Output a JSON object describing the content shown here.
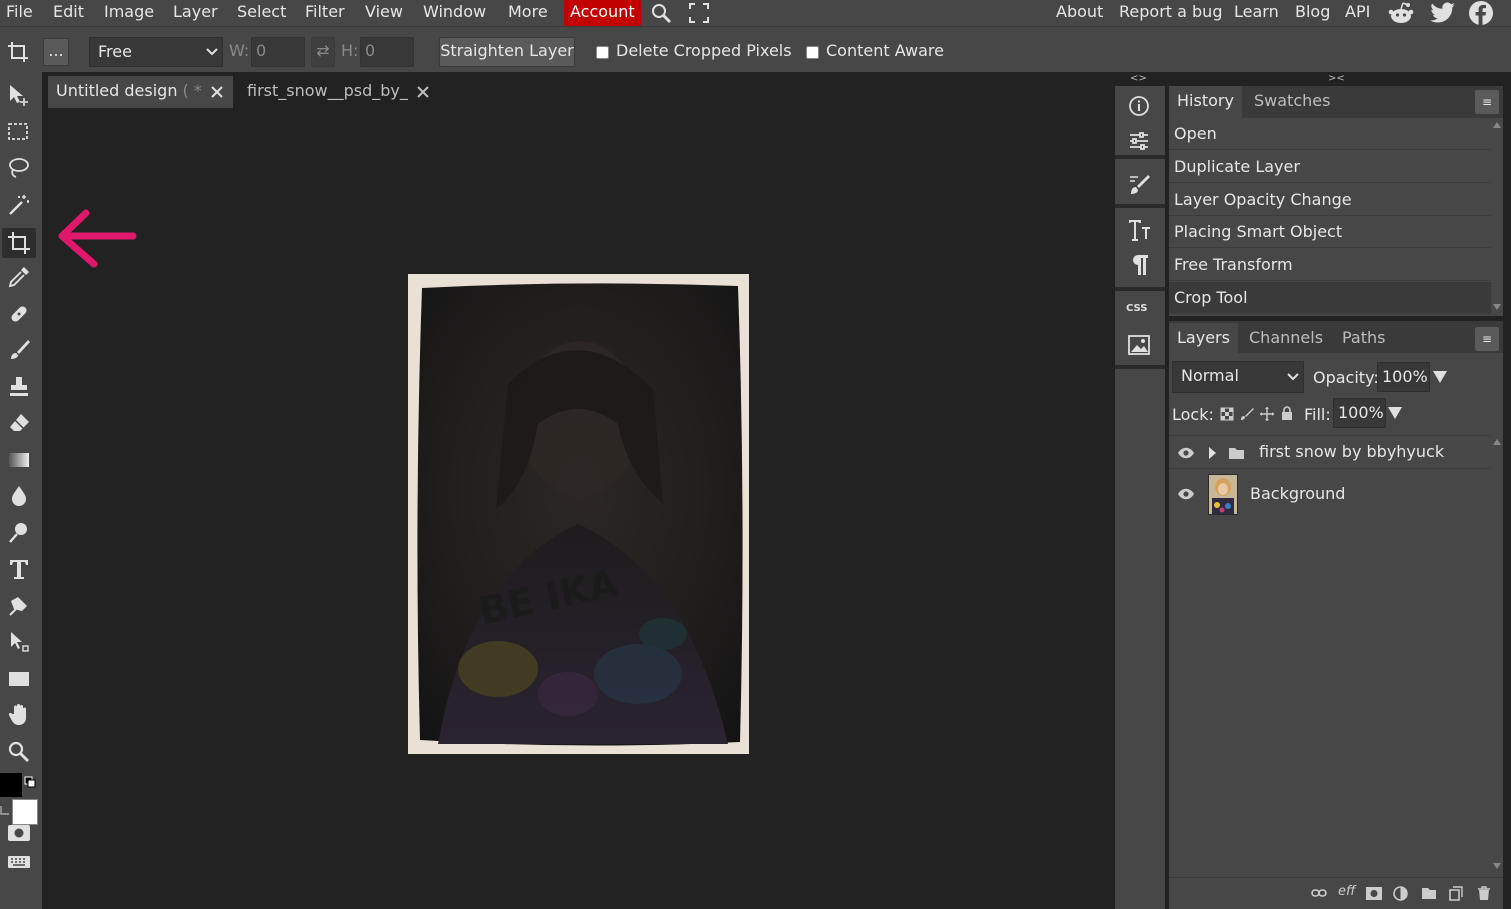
{
  "menu": {
    "left": [
      "File",
      "Edit",
      "Image",
      "Layer",
      "Select",
      "Filter",
      "View",
      "Window",
      "More"
    ],
    "account": "Account",
    "right": [
      "About",
      "Report a bug",
      "Learn",
      "Blog",
      "API"
    ],
    "colors": {
      "account_bg": "#c20000",
      "bar_bg": "#474747"
    }
  },
  "options": {
    "more_label": "...",
    "mode_value": "Free",
    "w_label": "W:",
    "w_value": "0",
    "swap_glyph": "⇄",
    "h_label": "H:",
    "h_value": "0",
    "straighten_label": "Straighten Layer",
    "delete_cropped_label": "Delete Cropped Pixels",
    "content_aware_label": "Content Aware"
  },
  "toolbar": {
    "tools": [
      "move-tool-icon",
      "marquee-tool-icon",
      "lasso-tool-icon",
      "magic-wand-tool-icon",
      "crop-tool-icon",
      "eyedropper-tool-icon",
      "healing-tool-icon",
      "brush-tool-icon",
      "clone-stamp-tool-icon",
      "eraser-tool-icon",
      "gradient-tool-icon",
      "blur-tool-icon",
      "dodge-tool-icon",
      "type-tool-icon",
      "pen-tool-icon",
      "path-select-tool-icon",
      "shape-tool-icon",
      "hand-tool-icon",
      "zoom-tool-icon"
    ],
    "foreground_color": "#000000",
    "background_color": "#ffffff",
    "annotation_arrow_color": "#e0186c"
  },
  "tabs": [
    {
      "label": "Untitled design",
      "suffix": "( *",
      "active": true
    },
    {
      "label": "first_snow__psd_by_",
      "suffix": "",
      "active": false
    }
  ],
  "collapse_left": "<>",
  "collapse_right": "><",
  "history": {
    "tabs": [
      "History",
      "Swatches"
    ],
    "items": [
      "Open",
      "Duplicate Layer",
      "Layer Opacity Change",
      "Placing Smart Object",
      "Free Transform",
      "Crop Tool"
    ],
    "menu_glyph": "≡"
  },
  "mini_panel": {
    "css_label": "CSS"
  },
  "layers": {
    "tabs": [
      "Layers",
      "Channels",
      "Paths"
    ],
    "menu_glyph": "≡",
    "blend_mode": "Normal",
    "opacity_label": "Opacity:",
    "opacity_value": "100%",
    "lock_label": "Lock:",
    "fill_label": "Fill:",
    "fill_value": "100%",
    "items": [
      {
        "name": "first snow by bbyhyuck",
        "type": "group"
      },
      {
        "name": "Background",
        "type": "image"
      }
    ],
    "footer_eff": "eff"
  }
}
